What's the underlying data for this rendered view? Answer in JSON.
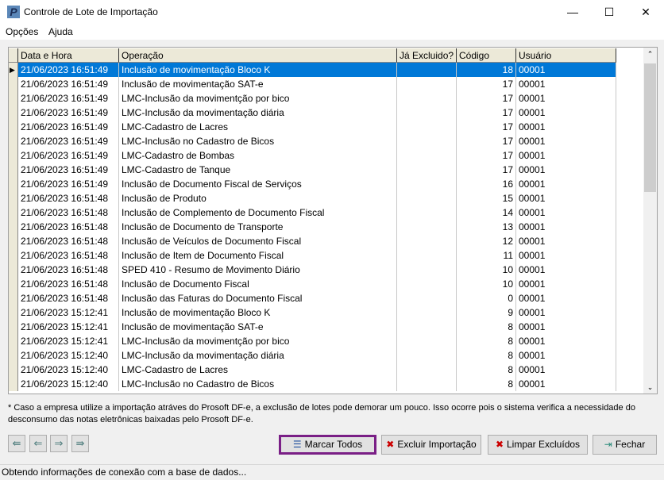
{
  "window": {
    "title": "Controle de Lote de Importação",
    "icon": "P",
    "minimize": "—",
    "maximize": "☐",
    "close": "✕"
  },
  "menu": [
    "Opções",
    "Ajuda"
  ],
  "grid": {
    "columns": [
      "Data e Hora",
      "Operação",
      "Já Excluido?",
      "Código",
      "Usuário"
    ],
    "selected_index": 0,
    "rows": [
      [
        "21/06/2023 16:51:49",
        "Inclusão de movimentação Bloco K",
        "",
        "18",
        "00001"
      ],
      [
        "21/06/2023 16:51:49",
        "Inclusão de movimentação SAT-e",
        "",
        "17",
        "00001"
      ],
      [
        "21/06/2023 16:51:49",
        "LMC-Inclusão da movimentção por bico",
        "",
        "17",
        "00001"
      ],
      [
        "21/06/2023 16:51:49",
        "LMC-Inclusão da movimentação diária",
        "",
        "17",
        "00001"
      ],
      [
        "21/06/2023 16:51:49",
        "LMC-Cadastro de Lacres",
        "",
        "17",
        "00001"
      ],
      [
        "21/06/2023 16:51:49",
        "LMC-Inclusão no Cadastro de Bicos",
        "",
        "17",
        "00001"
      ],
      [
        "21/06/2023 16:51:49",
        "LMC-Cadastro de Bombas",
        "",
        "17",
        "00001"
      ],
      [
        "21/06/2023 16:51:49",
        "LMC-Cadastro de Tanque",
        "",
        "17",
        "00001"
      ],
      [
        "21/06/2023 16:51:49",
        "Inclusão de Documento Fiscal de Serviços",
        "",
        "16",
        "00001"
      ],
      [
        "21/06/2023 16:51:48",
        "Inclusão de Produto",
        "",
        "15",
        "00001"
      ],
      [
        "21/06/2023 16:51:48",
        "Inclusão de Complemento de Documento Fiscal",
        "",
        "14",
        "00001"
      ],
      [
        "21/06/2023 16:51:48",
        "Inclusão de Documento de Transporte",
        "",
        "13",
        "00001"
      ],
      [
        "21/06/2023 16:51:48",
        "Inclusão de Veículos de Documento Fiscal",
        "",
        "12",
        "00001"
      ],
      [
        "21/06/2023 16:51:48",
        "Inclusão de Item de Documento Fiscal",
        "",
        "11",
        "00001"
      ],
      [
        "21/06/2023 16:51:48",
        "SPED 410 - Resumo de Movimento Diário",
        "",
        "10",
        "00001"
      ],
      [
        "21/06/2023 16:51:48",
        "Inclusão de Documento Fiscal",
        "",
        "10",
        "00001"
      ],
      [
        "21/06/2023 16:51:48",
        "Inclusão das Faturas do Documento Fiscal",
        "",
        "0",
        "00001"
      ],
      [
        "21/06/2023 15:12:41",
        "Inclusão de movimentação Bloco K",
        "",
        "9",
        "00001"
      ],
      [
        "21/06/2023 15:12:41",
        "Inclusão de movimentação SAT-e",
        "",
        "8",
        "00001"
      ],
      [
        "21/06/2023 15:12:41",
        "LMC-Inclusão da movimentção por bico",
        "",
        "8",
        "00001"
      ],
      [
        "21/06/2023 15:12:40",
        "LMC-Inclusão da movimentação diária",
        "",
        "8",
        "00001"
      ],
      [
        "21/06/2023 15:12:40",
        "LMC-Cadastro de Lacres",
        "",
        "8",
        "00001"
      ],
      [
        "21/06/2023 15:12:40",
        "LMC-Inclusão no Cadastro de Bicos",
        "",
        "8",
        "00001"
      ]
    ]
  },
  "note": "* Caso a empresa utilize a importação atráves do Prosoft DF-e, a exclusão de lotes pode demorar um pouco. Isso ocorre pois o sistema verifica a necessidade do desconsumo das notas eletrônicas baixadas pelo  Prosoft DF-e.",
  "buttons": {
    "first": "⇚",
    "prev": "⇐",
    "next": "⇒",
    "last": "⇛",
    "mark_all": "Marcar Todos",
    "delete_import": "Excluir Importação",
    "clear_deleted": "Limpar Excluídos",
    "close": "Fechar"
  },
  "status": "Obtendo informações de conexão com a base de dados..."
}
